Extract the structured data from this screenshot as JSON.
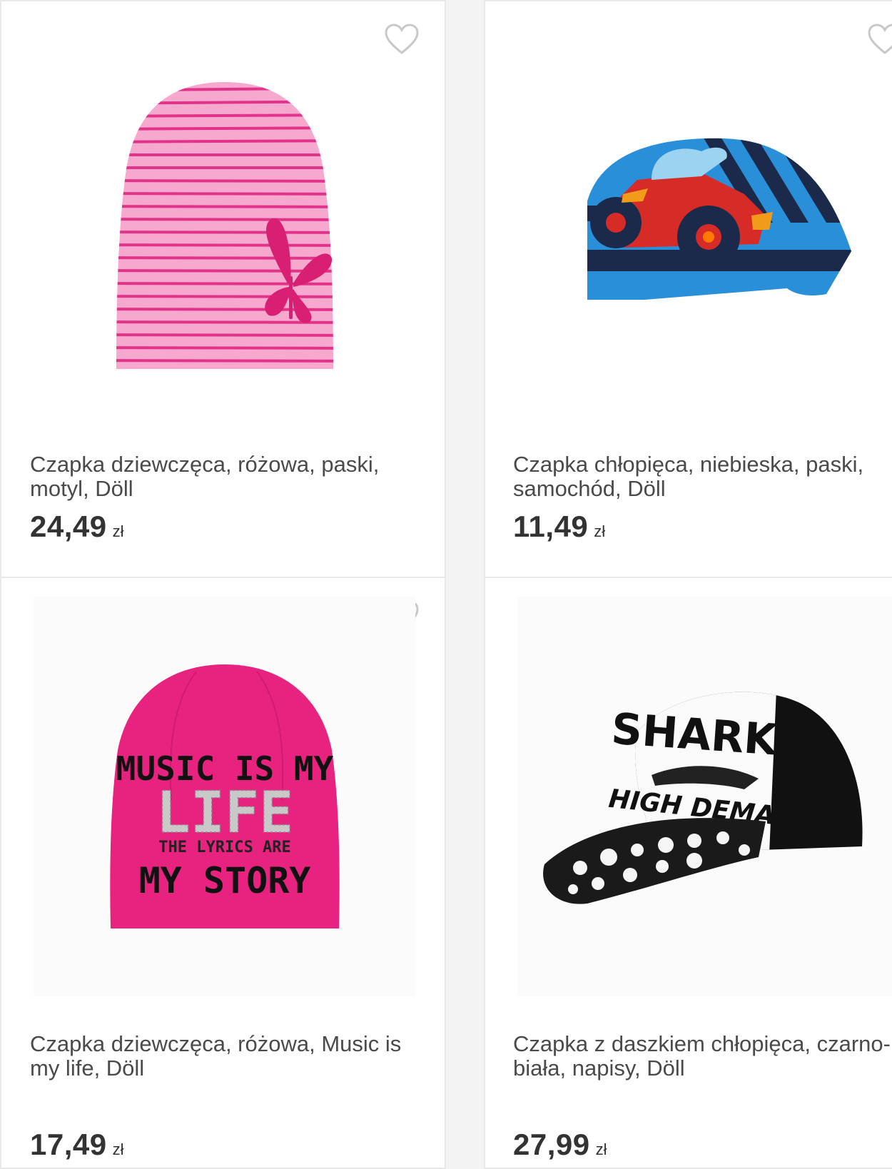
{
  "products": [
    {
      "title": "Czapka dziewczęca, różowa, paski, motyl, Döll",
      "price": "24,49",
      "currency": "zł"
    },
    {
      "title": "Czapka chłopięca, niebieska, paski, samochód, Döll",
      "price": "11,49",
      "currency": "zł"
    },
    {
      "title": "Czapka dziewczęca, różowa, Music is my life, Döll",
      "price": "17,49",
      "currency": "zł",
      "print_text": {
        "line1": "MUSIC IS MY",
        "line2": "LIFE",
        "line3": "THE LYRICS ARE",
        "line4": "MY STORY"
      }
    },
    {
      "title": "Czapka z daszkiem chłopięca, czarno-biała, napisy, Döll",
      "price": "27,99",
      "currency": "zł",
      "print_text": {
        "line1": "SHARKS",
        "line2": "HIGH DEMAND"
      }
    }
  ],
  "icons": {
    "favorite": "heart-outline-icon"
  },
  "colors": {
    "card_bg": "#ffffff",
    "page_bg": "#f3f3f3",
    "title": "#4a4a4a",
    "price": "#333333",
    "heart": "#c8c8c8"
  }
}
